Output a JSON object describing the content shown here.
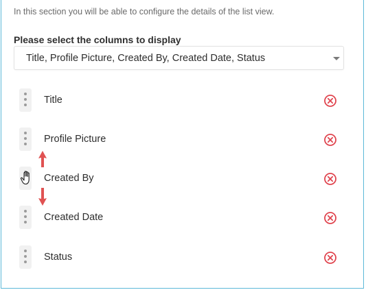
{
  "intro_text": "In this section you will be able to configure the details of the list view.",
  "columns_label": "Please select the columns to display",
  "columns_select": {
    "selected_value": "Title, Profile Picture, Created By, Created Date, Status"
  },
  "columns": [
    {
      "label": "Title"
    },
    {
      "label": "Profile Picture"
    },
    {
      "label": "Created By"
    },
    {
      "label": "Created Date"
    },
    {
      "label": "Status"
    }
  ],
  "icons": {
    "drag_handle": "vertical-dots-icon",
    "remove": "remove-circle-icon",
    "cursor": "grab-hand-icon",
    "drag_up": "arrow-up-icon",
    "drag_down": "arrow-down-icon"
  },
  "colors": {
    "border_accent": "#5bb8d8",
    "remove_red": "#e0454f",
    "arrow_red": "#e05252"
  }
}
